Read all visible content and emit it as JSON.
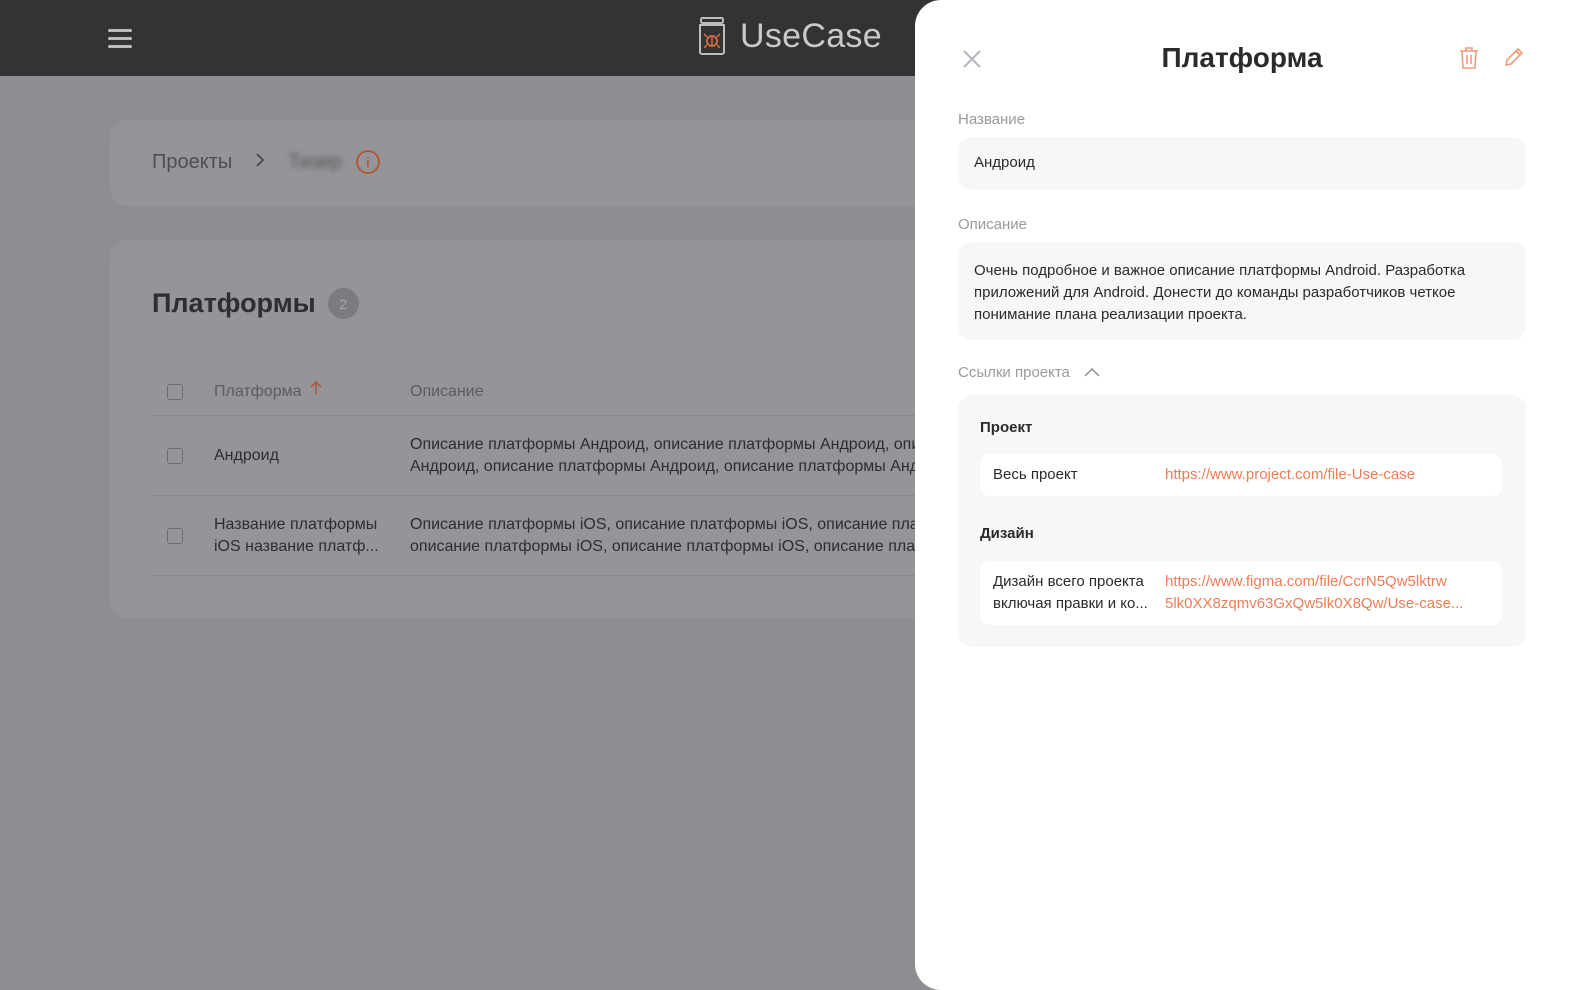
{
  "app": {
    "brand": "UseCase"
  },
  "breadcrumb": {
    "root": "Проекты",
    "current": "Тизер"
  },
  "list": {
    "title": "Платформы",
    "count": "2",
    "columns": {
      "name": "Платформа",
      "description": "Описание"
    },
    "rows": [
      {
        "name": "Андроид",
        "description_line1": "Описание платформы Андроид, описание платформы Андроид, описа",
        "description_line2": "Андроид, описание платформы Андроид, описание платформы Анд..."
      },
      {
        "name_line1": "Название платформы",
        "name_line2": "iOS название платф...",
        "description_line1": "Описание платформы iOS, описание платформы iOS, описание платфо",
        "description_line2": "описание платформы iOS, описание платформы iOS, описание платфо"
      }
    ]
  },
  "panel": {
    "title": "Платформа",
    "name_label": "Название",
    "name_value": "Андроид",
    "description_label": "Описание",
    "description_line1": "Очень подробное и важное описание платформы Android. Разработка",
    "description_line2": "приложений для Android. Донести до команды разработчиков четкое",
    "description_line3": "понимание плана реализации проекта.",
    "links_label": "Ссылки проекта",
    "groups": [
      {
        "title": "Проект",
        "links": [
          {
            "name": "Весь проект",
            "url": "https://www.project.com/file-Use-case"
          }
        ]
      },
      {
        "title": "Дизайн",
        "links": [
          {
            "name_line1": "Дизайн всего проекта",
            "name_line2": "включая правки и ко...",
            "url_line1": "https://www.figma.com/file/CcrN5Qw5lktrw",
            "url_line2": "5lk0XX8zqmv63GxQw5lk0X8Qw/Use-case..."
          }
        ]
      }
    ]
  },
  "icons": {
    "menu": "hamburger-icon",
    "logo": "jar-bug-icon",
    "chevron": "chevron-right-icon",
    "info": "info-icon",
    "sort": "arrow-up-icon",
    "close": "close-icon",
    "trash": "trash-icon",
    "edit": "pencil-icon",
    "collapse": "chevron-up-icon"
  },
  "colors": {
    "accent": "#f07c55",
    "topbar": "#333335",
    "overlay": "#8e8e92",
    "panel": "#ffffff"
  }
}
